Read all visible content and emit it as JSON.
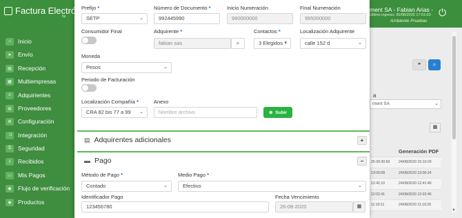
{
  "header": {
    "logo_text": "Factura Electrónic",
    "logo_by": "by",
    "user_text": "ment SA - Fabian Arias -",
    "last_login": "Último ingreso: 25/08/2020 17:01:03",
    "environment": "Ambiente Pruebas",
    "logout_icon": "logout-icon"
  },
  "sidebar": {
    "items": [
      {
        "label": "Inicio",
        "icon": "home-icon"
      },
      {
        "label": "Envío",
        "icon": "send-icon"
      },
      {
        "label": "Recepción",
        "icon": "inbox-icon"
      },
      {
        "label": "Multiempresas",
        "icon": "building-icon"
      },
      {
        "label": "Adquirientes",
        "icon": "users-icon"
      },
      {
        "label": "Proveedores",
        "icon": "truck-icon"
      },
      {
        "label": "Configuración",
        "icon": "gear-icon"
      },
      {
        "label": "Integración",
        "icon": "shuffle-icon"
      },
      {
        "label": "Seguridad",
        "icon": "lock-icon"
      },
      {
        "label": "Recibidos",
        "icon": "download-icon"
      },
      {
        "label": "Mis Pagos",
        "icon": "card-icon"
      },
      {
        "label": "Flujo de verificación",
        "icon": "eye-icon"
      },
      {
        "label": "Productos",
        "icon": "tag-icon"
      }
    ]
  },
  "background": {
    "a_label": "a",
    "select_value": "ment SA",
    "table_header": [
      "",
      "Generación PDF"
    ],
    "table_rows": [
      [
        "25 09:30:50",
        "24/08/2020 15:10:29"
      ],
      [
        "13:00:08",
        "24/08/2020 13:00:24"
      ],
      [
        "12:41:10",
        "24/08/2020 12:41:46"
      ],
      [
        "12:02:41",
        "24/08/2020 12:02:46"
      ],
      [
        "11:19:11",
        "24/08/2020 11:19:25"
      ]
    ]
  },
  "form": {
    "prefijo": {
      "label": "Prefijo",
      "value": "SETP"
    },
    "numero_documento": {
      "label": "Número de Documento",
      "value": "992445990"
    },
    "inicio_numeracion": {
      "label": "Inicio Numeración",
      "value": "990000000"
    },
    "final_numeracion": {
      "label": "Final Numeración",
      "value": "995000000"
    },
    "consumidor_final": {
      "label": "Consumidor Final"
    },
    "adquirente": {
      "label": "Adquirente",
      "value": "fabian sas"
    },
    "contactos": {
      "label": "Contactos",
      "value": "3 Elegidos"
    },
    "localizacion_adquirente": {
      "label": "Localización Adquirente",
      "value": "calle 152 d"
    },
    "moneda": {
      "label": "Moneda",
      "value": "Pesos"
    },
    "periodo_facturacion": {
      "label": "Periodo de Facturación"
    },
    "localizacion_compania": {
      "label": "Localización Compañía",
      "value": "CRA 82 bis 77 a 99"
    },
    "anexo": {
      "label": "Anexo",
      "placeholder": "Nombre archivo"
    },
    "subir_label": "Subir",
    "required_mark": "*"
  },
  "sections": {
    "adquirentes_adicionales": {
      "title": "Adquirentes adicionales",
      "toggle": "+"
    },
    "pago": {
      "title": "Pago",
      "toggle": "−"
    }
  },
  "pago": {
    "metodo_pago": {
      "label": "Método de Pago",
      "value": "Contado"
    },
    "medio_pago": {
      "label": "Medio Pago",
      "value": "Efectivo"
    },
    "identificador_pago": {
      "label": "Identificador Pago",
      "value": "123456780"
    },
    "fecha_vencimiento": {
      "label": "Fecha Vencimiento",
      "value": "26-08-2020"
    }
  },
  "colors": {
    "header_green": "#3c8f3c",
    "section_green": "#5cb85c",
    "button_green": "#29b341",
    "required_blue": "#1e6fd9",
    "button_blue": "#2a7fd0"
  }
}
